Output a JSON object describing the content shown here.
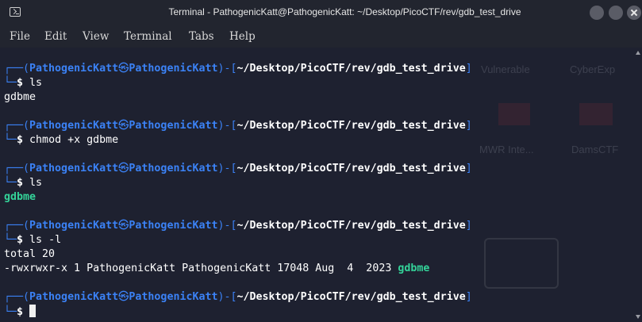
{
  "window": {
    "title": "Terminal - PathogenicKatt@PathogenicKatt: ~/Desktop/PicoCTF/rev/gdb_test_drive"
  },
  "menu": {
    "file": "File",
    "edit": "Edit",
    "view": "View",
    "terminal": "Terminal",
    "tabs": "Tabs",
    "help": "Help"
  },
  "prompt": {
    "top_open": "┌──(",
    "user": "PathogenicKatt",
    "at": "㉿",
    "host": "PathogenicKatt",
    "mid": ")-[",
    "path": "~/Desktop/PicoCTF/rev/gdb_test_drive",
    "close": "]",
    "bottom": "└─",
    "dollar": "$"
  },
  "session": {
    "cmd1": "ls",
    "out1": "gdbme",
    "cmd2": "chmod +x gdbme",
    "cmd3": "ls",
    "out3": "gdbme",
    "cmd4": "ls -l",
    "out4_total": "total 20",
    "out4_line": "-rwxrwxr-x 1 PathogenicKatt PathogenicKatt 17048 Aug  4  2023 ",
    "out4_file": "gdbme"
  },
  "background_ghost": {
    "t1": "Vulnerable",
    "t2": "CyberExp",
    "t3": "MWR Inte...",
    "t4": "DamsCTF"
  },
  "colors": {
    "prompt_blue": "#3b82f6",
    "exec_green": "#34d399",
    "terminal_bg": "#1e2130",
    "titlebar_bg": "#22252f"
  }
}
